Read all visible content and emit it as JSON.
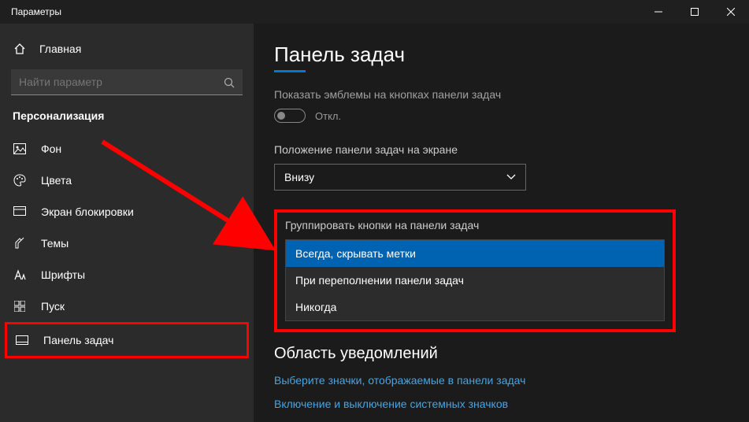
{
  "window": {
    "title": "Параметры"
  },
  "sidebar": {
    "home": "Главная",
    "search_placeholder": "Найти параметр",
    "section": "Персонализация",
    "items": [
      {
        "label": "Фон"
      },
      {
        "label": "Цвета"
      },
      {
        "label": "Экран блокировки"
      },
      {
        "label": "Темы"
      },
      {
        "label": "Шрифты"
      },
      {
        "label": "Пуск"
      },
      {
        "label": "Панель задач"
      }
    ]
  },
  "content": {
    "heading": "Панель задач",
    "badges_label": "Показать эмблемы на кнопках панели задач",
    "toggle_off": "Откл.",
    "position_label": "Положение панели задач на экране",
    "position_value": "Внизу",
    "group_label": "Группировать кнопки на панели задач",
    "group_options": [
      "Всегда, скрывать метки",
      "При переполнении панели задач",
      "Никогда"
    ],
    "section2": "Область уведомлений",
    "link1": "Выберите значки, отображаемые в панели задач",
    "link2": "Включение и выключение системных значков"
  }
}
